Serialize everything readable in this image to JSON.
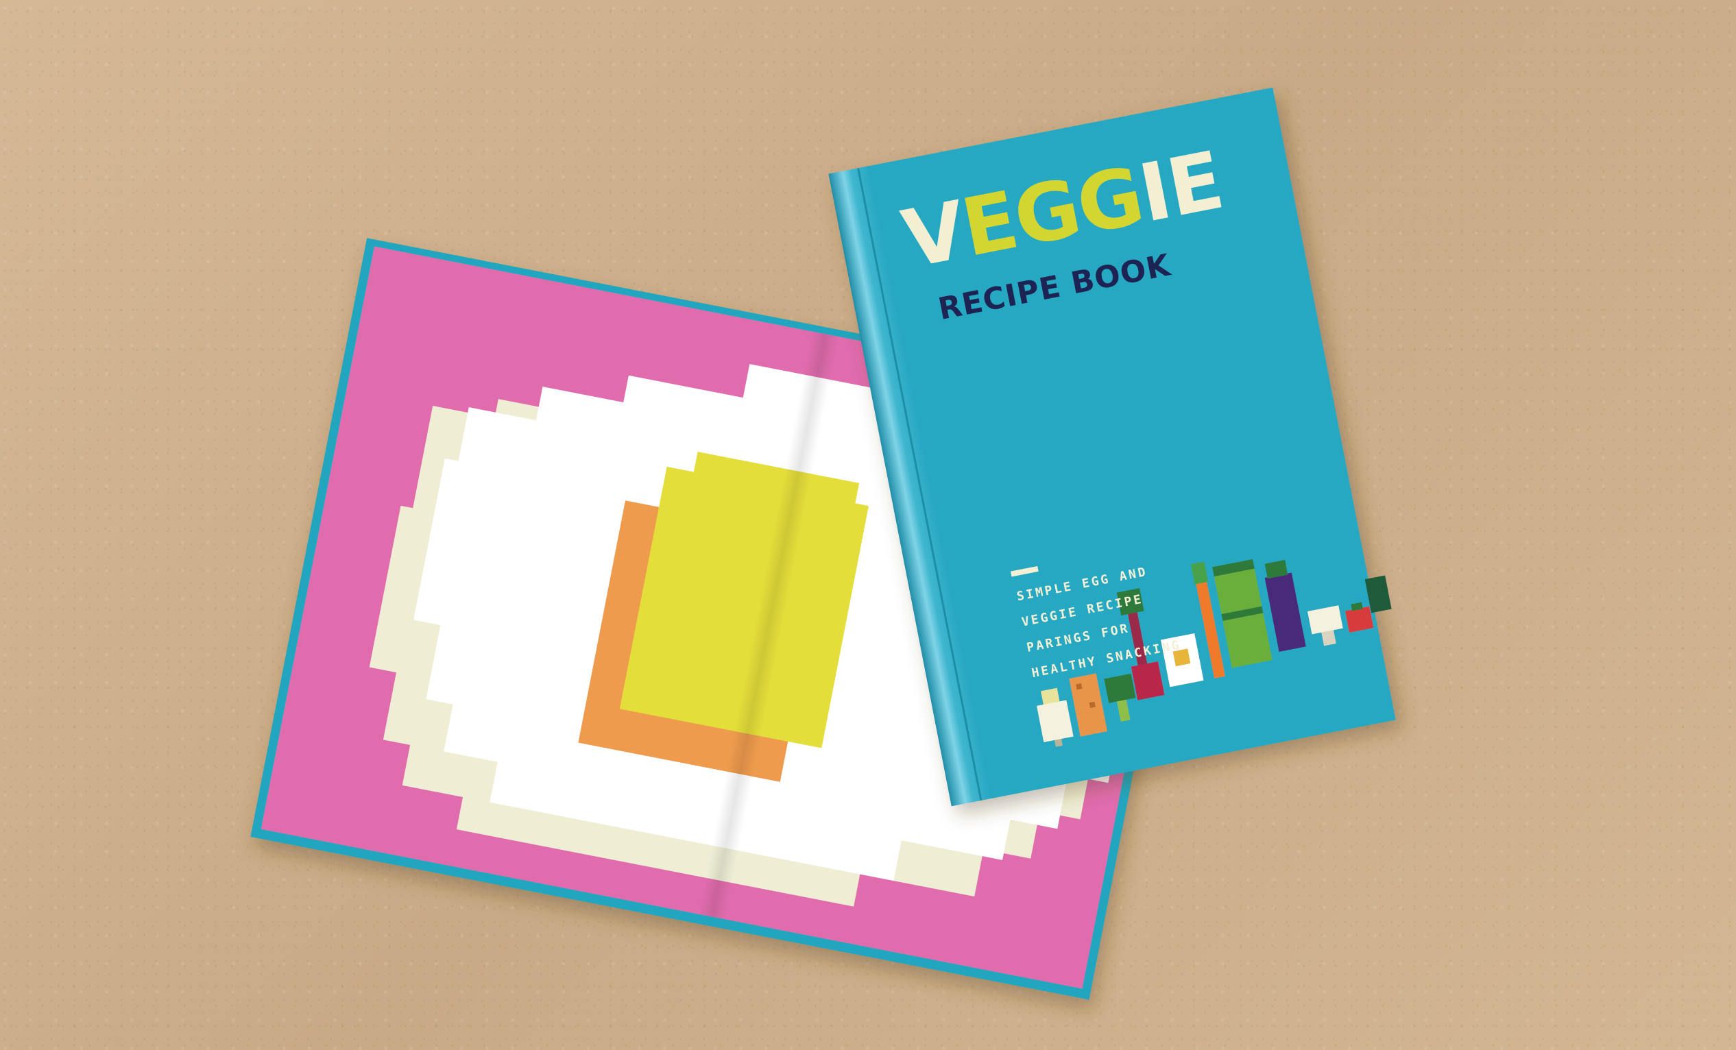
{
  "cover": {
    "title_letters": [
      {
        "char": "V",
        "color": "#f3efd3"
      },
      {
        "char": "E",
        "color": "#d3d531"
      },
      {
        "char": "G",
        "color": "#d3d531"
      },
      {
        "char": "G",
        "color": "#d3d531"
      },
      {
        "char": "I",
        "color": "#f3efd3"
      },
      {
        "char": "E",
        "color": "#f3efd3"
      }
    ],
    "subtitle": "RECIPE BOOK",
    "tagline": [
      "SIMPLE EGG AND",
      "VEGGIE RECIPE",
      "PARINGS FOR",
      "HEALTHY SNACKING"
    ]
  },
  "colors": {
    "kraft": "#cfb18f",
    "cover_blue": "#27a7c2",
    "inner_pink": "#e06cae",
    "egg_white": "#ffffff",
    "egg_shadow": "#efeed5",
    "yolk": "#e4de3a",
    "yolk_shadow": "#ee9b4d",
    "title_navy": "#1d2352"
  },
  "illustration": {
    "vegetables": [
      "garlic-icon",
      "sweet-potato-icon",
      "broccoli-icon",
      "beet-icon",
      "egg-icon",
      "carrot-icon",
      "asparagus-icon",
      "eggplant-icon",
      "cauliflower-icon",
      "tomato-icon",
      "kale-icon"
    ]
  }
}
